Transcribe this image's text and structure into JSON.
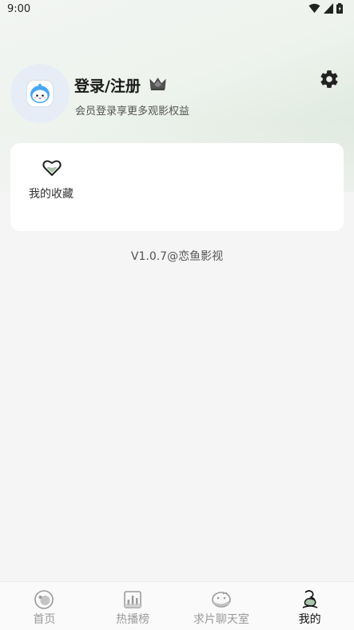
{
  "status_bar": {
    "time": "9:00"
  },
  "profile": {
    "title": "登录/注册",
    "subtitle": "会员登录享更多观影权益"
  },
  "favorites": {
    "label": "我的收藏"
  },
  "version": "V1.0.7@恋鱼影视",
  "bottom_nav": {
    "items": [
      {
        "label": "首页",
        "icon": "home-icon",
        "active": false
      },
      {
        "label": "热播榜",
        "icon": "chart-icon",
        "active": false
      },
      {
        "label": "求片聊天室",
        "icon": "chat-icon",
        "active": false
      },
      {
        "label": "我的",
        "icon": "profile-icon",
        "active": true
      }
    ]
  },
  "colors": {
    "inactive": "#9a9a9a",
    "active": "#111111",
    "accent_green": "#d6e4d6"
  }
}
